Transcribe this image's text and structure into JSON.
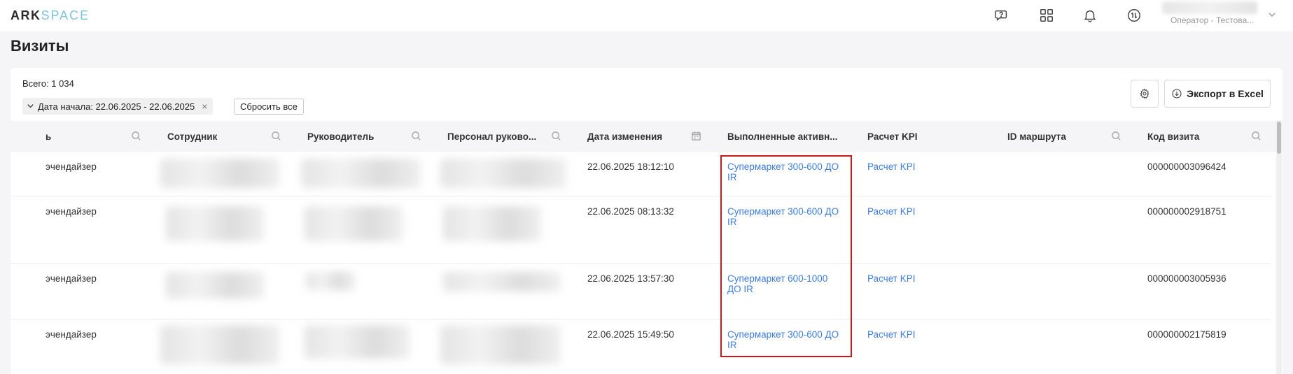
{
  "app": {
    "logo_ark": "ARK",
    "logo_space": "SPACE"
  },
  "topbar": {
    "icons": [
      "help-chat-icon",
      "apps-grid-icon",
      "bell-icon",
      "sync-icon"
    ],
    "user_role": "Оператор - Тестова..."
  },
  "page": {
    "title": "Визиты"
  },
  "summary": {
    "total": "Всего: 1 034"
  },
  "filter": {
    "label": "Дата начала: 22.06.2025 - 22.06.2025",
    "reset_label": "Сбросить все"
  },
  "toolbar": {
    "export_label": "Экспорт в Excel"
  },
  "table": {
    "columns": [
      {
        "label": "ь",
        "icon": "search-icon"
      },
      {
        "label": "Сотрудник",
        "icon": "search-icon"
      },
      {
        "label": "Руководитель",
        "icon": "search-icon"
      },
      {
        "label": "Персонал руково...",
        "icon": "search-icon"
      },
      {
        "label": "Дата изменения",
        "icon": "calendar-icon"
      },
      {
        "label": "Выполненные активн...",
        "icon": ""
      },
      {
        "label": "Расчет KPI",
        "icon": ""
      },
      {
        "label": "ID маршрута",
        "icon": "search-icon"
      },
      {
        "label": "Код визита",
        "icon": "search-icon"
      }
    ],
    "rows": [
      {
        "role": "эчендайзер",
        "date": "22.06.2025 18:12:10",
        "activity_line1": "Супермаркет 300-600 ДО",
        "activity_line2": "IR",
        "kpi": "Расчет KPI",
        "route_id": "",
        "visit_code": "000000003096424"
      },
      {
        "role": "эчендайзер",
        "date": "22.06.2025 08:13:32",
        "activity_line1": "Супермаркет 300-600 ДО",
        "activity_line2": "IR",
        "kpi": "Расчет KPI",
        "route_id": "",
        "visit_code": "000000002918751"
      },
      {
        "role": "эчендайзер",
        "date": "22.06.2025 13:57:30",
        "activity_line1": "Супермаркет 600-1000",
        "activity_line2": "ДО IR",
        "kpi": "Расчет KPI",
        "route_id": "",
        "visit_code": "000000003005936"
      },
      {
        "role": "эчендайзер",
        "date": "22.06.2025 15:49:50",
        "activity_line1": "Супермаркет 300-600 ДО",
        "activity_line2": "IR",
        "kpi": "Расчет KPI",
        "route_id": "",
        "visit_code": "000000002175819"
      }
    ]
  },
  "colors": {
    "link": "#3d7ede",
    "highlight": "#d01818",
    "logo_accent": "#7fc3d8"
  }
}
